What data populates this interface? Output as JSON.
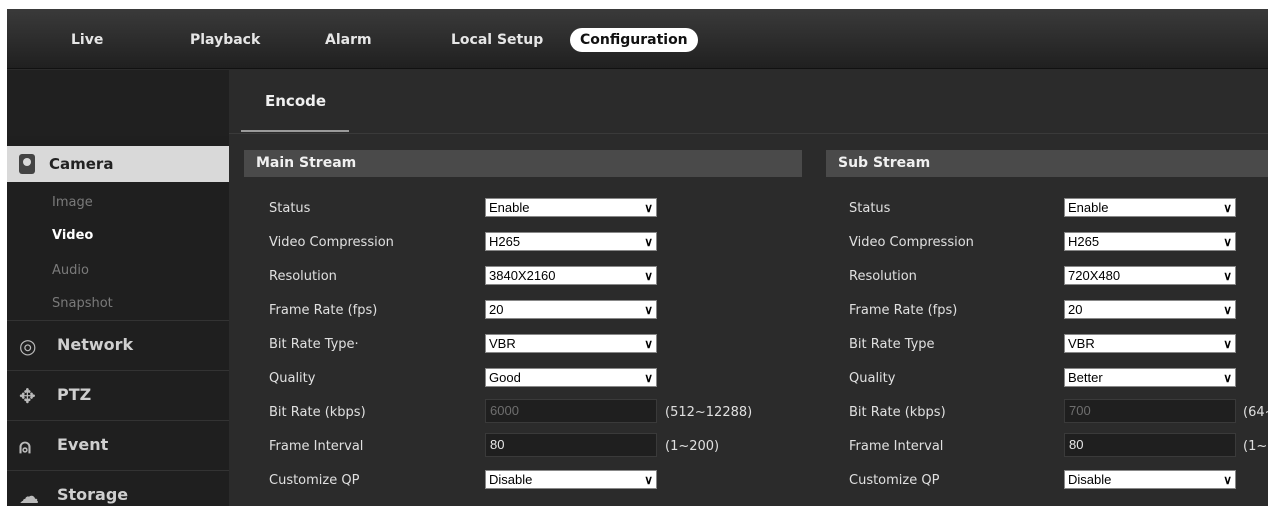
{
  "nav": {
    "tabs": [
      "Live",
      "Playback",
      "Alarm",
      "Local Setup",
      "Configuration"
    ]
  },
  "sidebar": {
    "camera": "Camera",
    "sub_items": [
      "Image",
      "Video",
      "Audio",
      "Snapshot"
    ],
    "sections": [
      "Network",
      "PTZ",
      "Event",
      "Storage"
    ]
  },
  "page": {
    "subtab": "Encode"
  },
  "main_stream": {
    "title": "Main Stream",
    "labels": [
      "Status",
      "Video Compression",
      "Resolution",
      "Frame Rate (fps)",
      "Bit Rate Type·",
      "Quality",
      "Bit Rate (kbps)",
      "Frame Interval",
      "Customize QP"
    ],
    "status": "Enable",
    "compression": "H265",
    "resolution": "3840X2160",
    "frame_rate": "20",
    "bit_rate_type": "VBR",
    "quality": "Good",
    "bit_rate": "6000",
    "bit_rate_range": "(512~12288)",
    "frame_interval": "80",
    "frame_interval_range": "(1~200)",
    "customize_qp": "Disable"
  },
  "sub_stream": {
    "title": "Sub Stream",
    "labels": [
      "Status",
      "Video Compression",
      "Resolution",
      "Frame Rate (fps)",
      "Bit Rate Type",
      "Quality",
      "Bit Rate (kbps)",
      "Frame Interval",
      "Customize QP"
    ],
    "status": "Enable",
    "compression": "H265",
    "resolution": "720X480",
    "frame_rate": "20",
    "bit_rate_type": "VBR",
    "quality": "Better",
    "bit_rate": "700",
    "bit_rate_range": "(64~",
    "frame_interval": "80",
    "frame_interval_range": "(1~",
    "customize_qp": "Disable"
  },
  "icons": {
    "chevron": "chevron-down-icon"
  }
}
